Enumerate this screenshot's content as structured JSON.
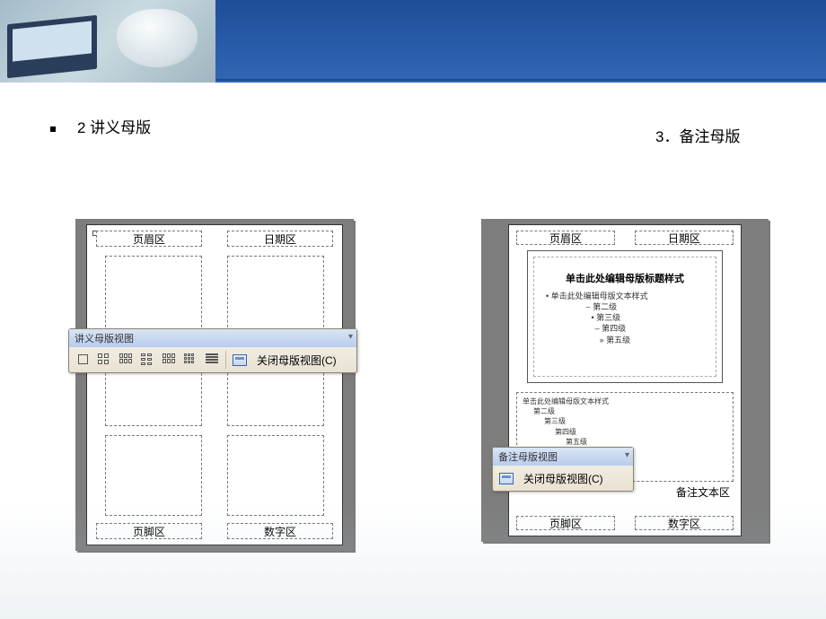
{
  "captions": {
    "left": "2 讲义母版",
    "right": "3．备注母版"
  },
  "left_paper": {
    "header_left": "页眉区",
    "header_right": "日期区",
    "footer_left": "页脚区",
    "footer_right": "数字区"
  },
  "right_paper": {
    "header_left": "页眉区",
    "header_right": "日期区",
    "footer_left": "页脚区",
    "footer_right": "数字区",
    "slide_title": "单击此处编辑母版标题样式",
    "slide_body_l1": "• 单击此处编辑母版文本样式",
    "slide_body_l2": "– 第二级",
    "slide_body_l3": "• 第三级",
    "slide_body_l4": "– 第四级",
    "slide_body_l5": "» 第五级",
    "notes_l1": "单击此处编辑母版文本样式",
    "notes_l2": "第二级",
    "notes_l3": "第三级",
    "notes_l4": "第四级",
    "notes_l5": "第五级",
    "notes_area_label": "备注文本区"
  },
  "toolbar1": {
    "title": "讲义母版视图",
    "close": "关闭母版视图(C)"
  },
  "toolbar2": {
    "title": "备注母版视图",
    "close": "关闭母版视图(C)"
  }
}
